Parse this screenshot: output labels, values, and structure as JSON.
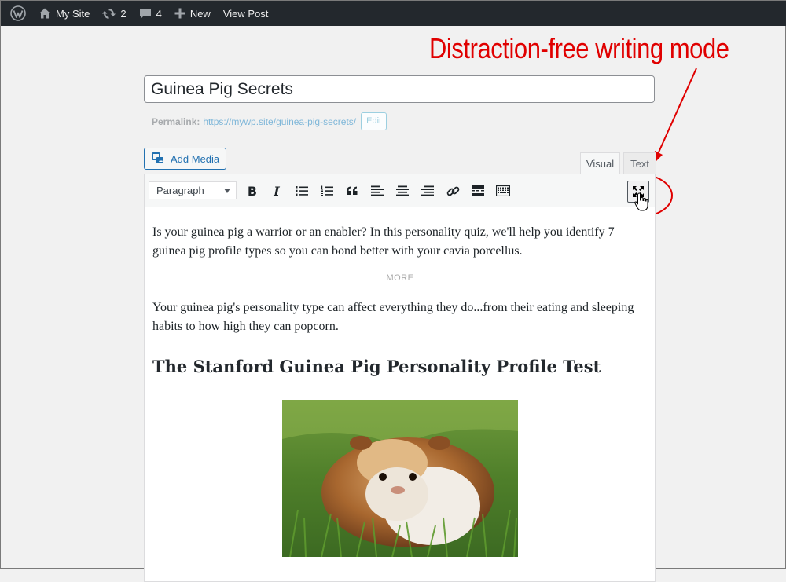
{
  "admin_bar": {
    "site_name": "My Site",
    "updates_count": "2",
    "comments_count": "4",
    "new_label": "New",
    "view_post_label": "View Post"
  },
  "annotation": {
    "text": "Distraction-free writing mode",
    "color": "#e00000"
  },
  "post": {
    "title": "Guinea Pig Secrets",
    "permalink_label": "Permalink:",
    "permalink_base": "https://mywp.site/",
    "permalink_slug": "guinea-pig-secrets",
    "permalink_trailing": "/",
    "edit_label": "Edit"
  },
  "editor": {
    "add_media_label": "Add Media",
    "tabs": {
      "visual": "Visual",
      "text": "Text"
    },
    "format_select": "Paragraph",
    "toolbar_icons": [
      "bold-icon",
      "italic-icon",
      "bulleted-list-icon",
      "numbered-list-icon",
      "blockquote-icon",
      "align-left-icon",
      "align-center-icon",
      "align-right-icon",
      "link-icon",
      "read-more-icon",
      "toolbar-toggle-icon",
      "distraction-free-icon"
    ],
    "content": {
      "paragraph1": "Is your guinea pig a warrior or an enabler? In this personality quiz, we'll help you identify 7 guinea pig profile types so you can bond better with your cavia porcellus.",
      "more_label": "MORE",
      "paragraph2": "Your guinea pig's personality type can affect everything they do...from their eating and sleeping habits to how high they can popcorn.",
      "heading": "The Stanford Guinea Pig Personality Profile Test"
    }
  },
  "colors": {
    "admin_bar_bg": "#23282d",
    "accent_blue": "#2271b1"
  }
}
